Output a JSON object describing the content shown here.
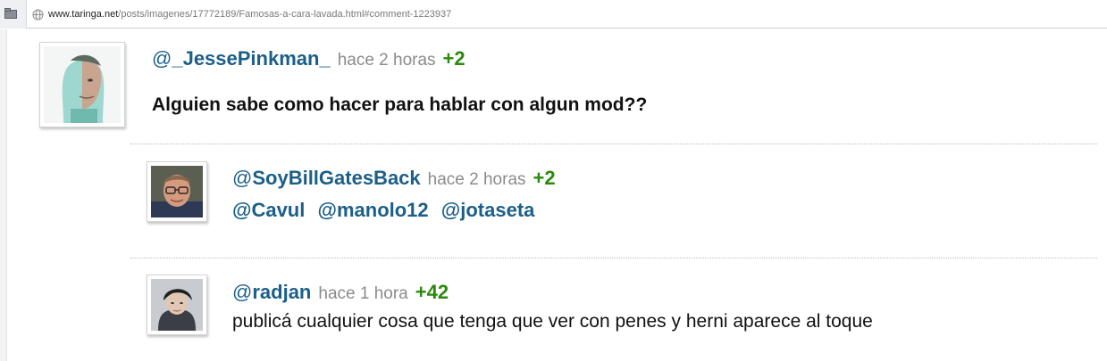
{
  "browser": {
    "url_domain": "www.taringa.net",
    "url_path": "/posts/imagenes/17772189/Famosas-a-cara-lavada.html#comment-1223937"
  },
  "comments": [
    {
      "at": "@",
      "username": "_JessePinkman_",
      "time": "hace 2 horas",
      "votes": "+2",
      "text": "Alguien sabe como hacer para hablar con algun mod??"
    },
    {
      "at": "@",
      "username": "SoyBillGatesBack",
      "time": "hace 2 horas",
      "votes": "+2",
      "mentions": [
        "@Cavul",
        "@manolo12",
        "@jotaseta"
      ]
    },
    {
      "at": "@",
      "username": "radjan",
      "time": "hace 1 hora",
      "votes": "+42",
      "text": "publicá cualquier cosa que tenga que ver con penes y herni aparece al toque"
    }
  ],
  "colors": {
    "username": "#1b5f89",
    "votes": "#2a8a0c",
    "time": "#8b8b8b"
  },
  "icons": [
    "tab-icon",
    "globe-icon"
  ]
}
